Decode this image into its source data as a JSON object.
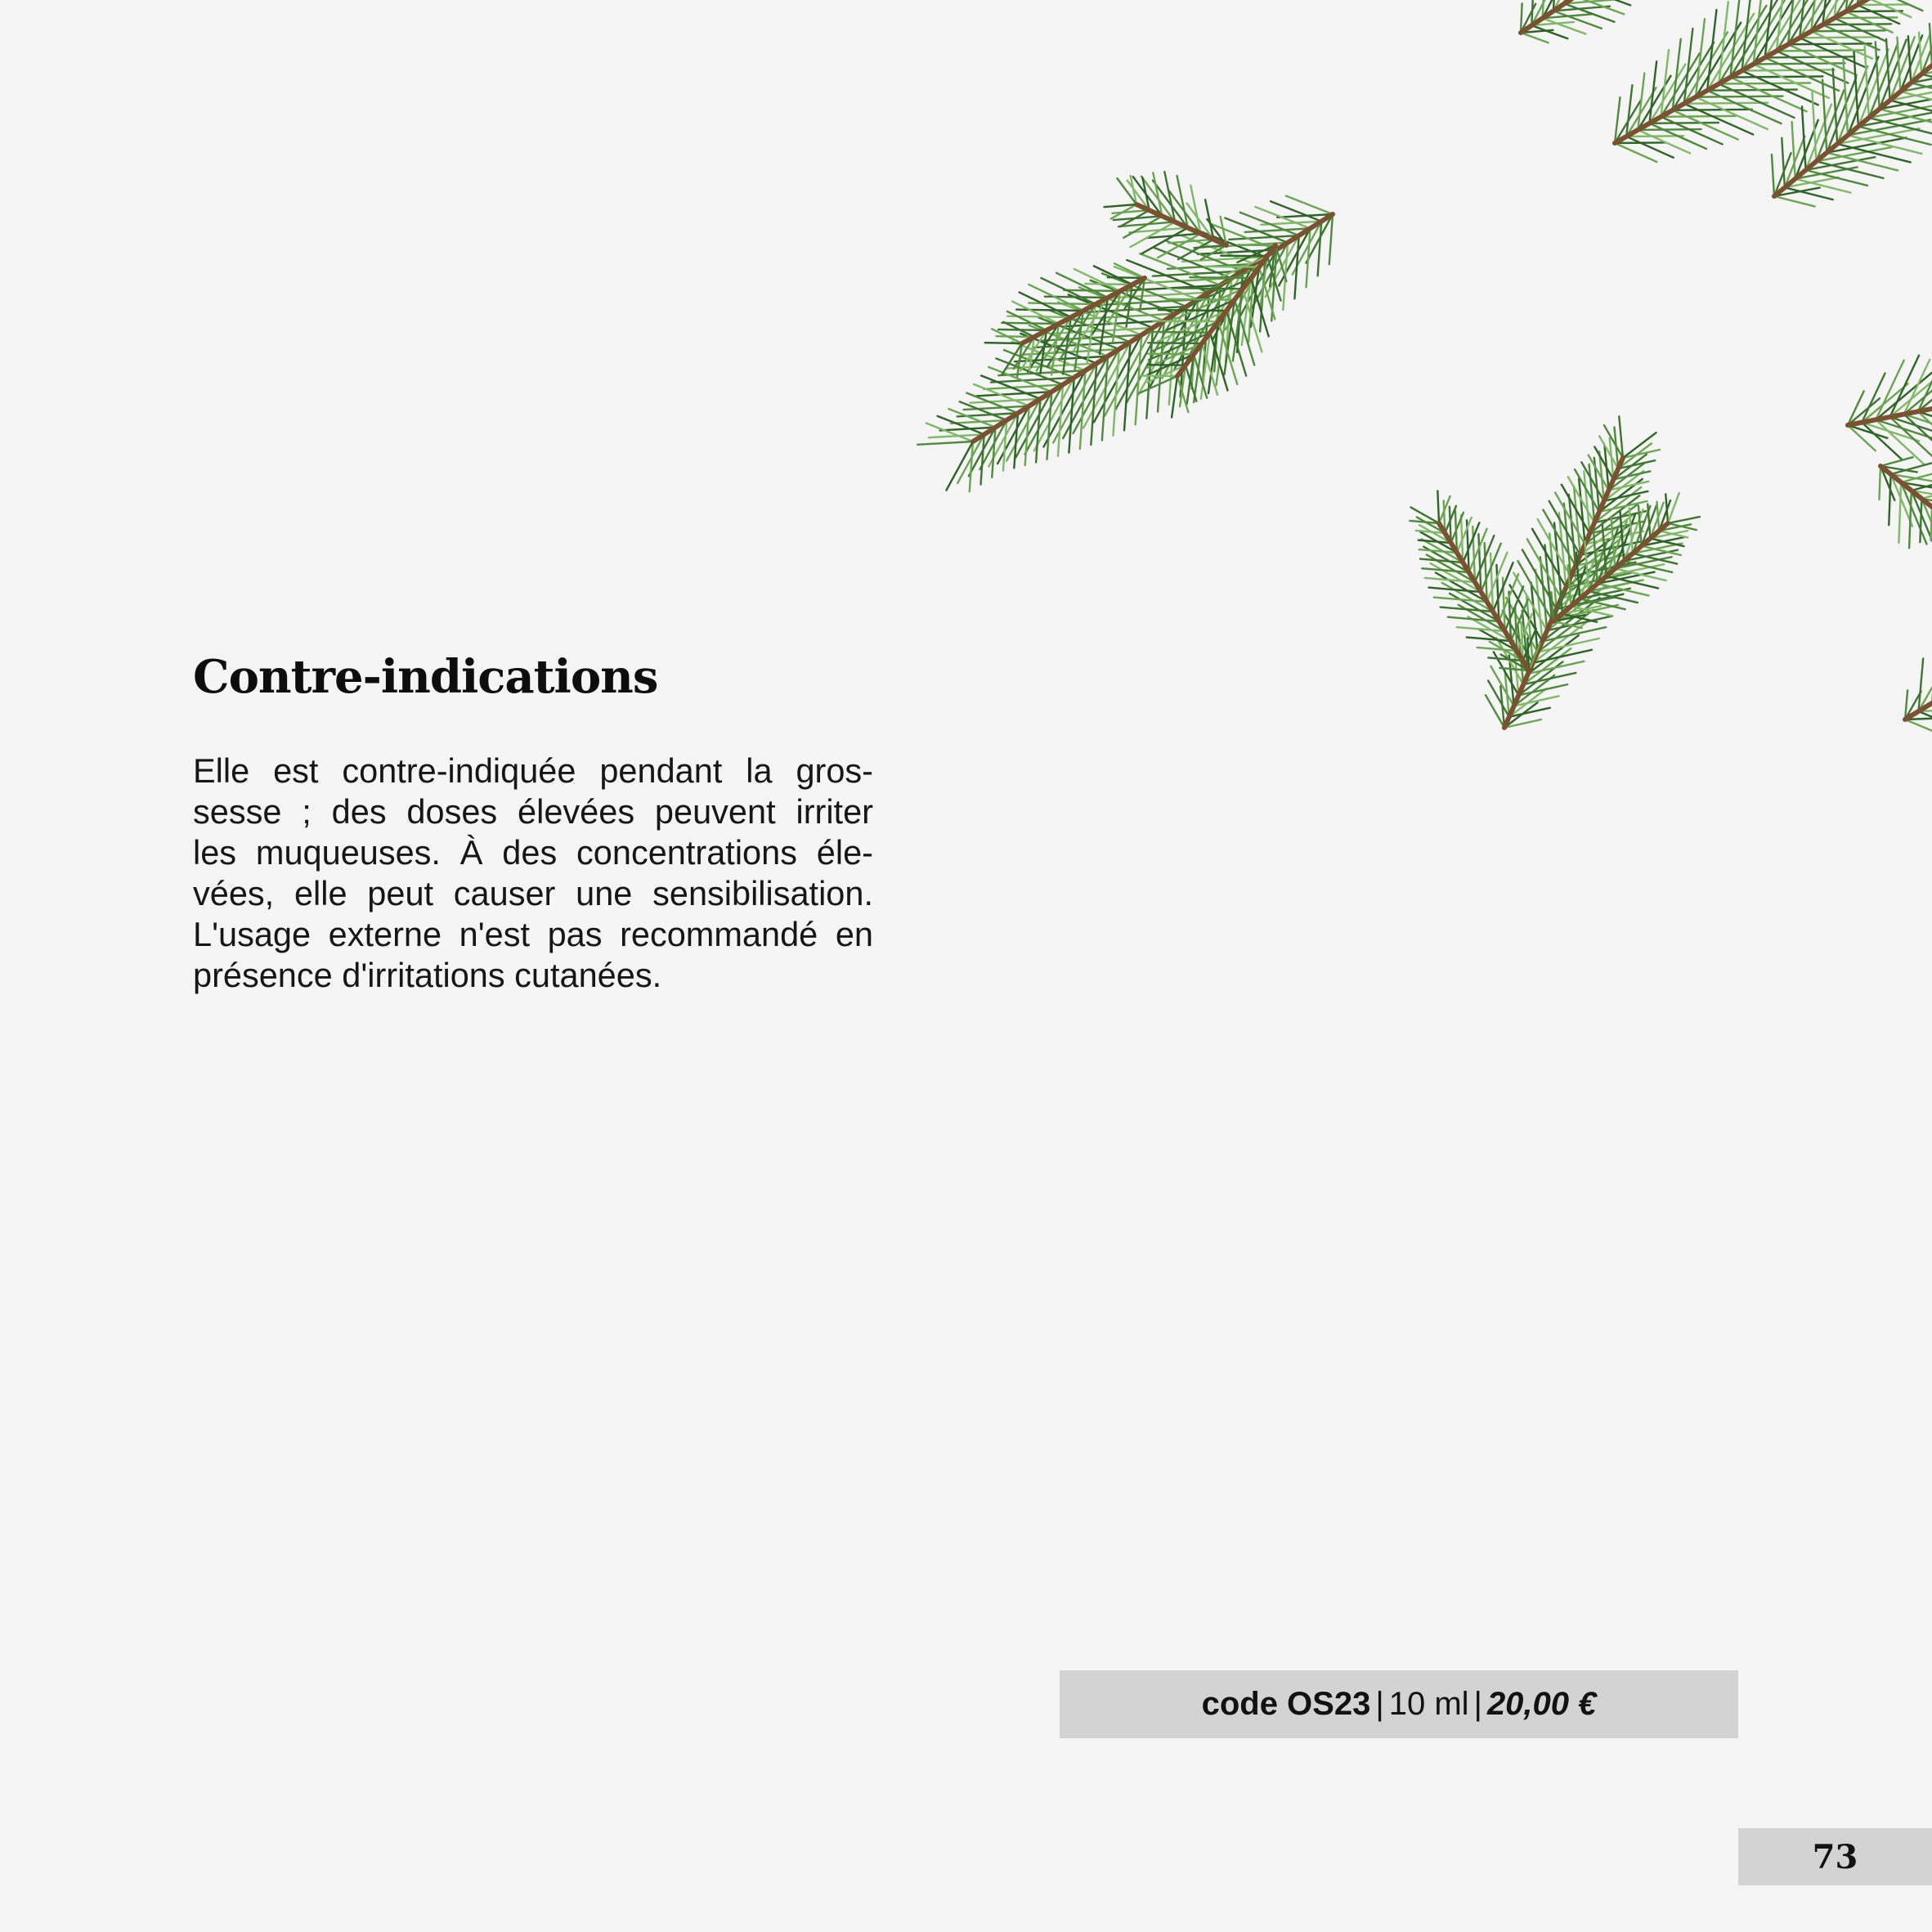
{
  "section": {
    "title": "Contre-indications",
    "lines": [
      "Elle est contre-indiquée pendant la gros-",
      "sesse ; des doses élevées peuvent irriter",
      "les muqueuses. À des concentrations éle-",
      "vées, elle peut causer une sensibilisation.",
      "L'usage externe n'est pas recommandé en",
      "présence d'irritations cutanées."
    ]
  },
  "product": {
    "code": "code OS23",
    "separator1": "|",
    "volume": "10 ml",
    "separator2": "|",
    "price": "20,00 €"
  },
  "page_number": "73",
  "decoration": {
    "image": "pine-branches",
    "needle_color": "#4f8a3c",
    "stem_color": "#7a5231"
  }
}
